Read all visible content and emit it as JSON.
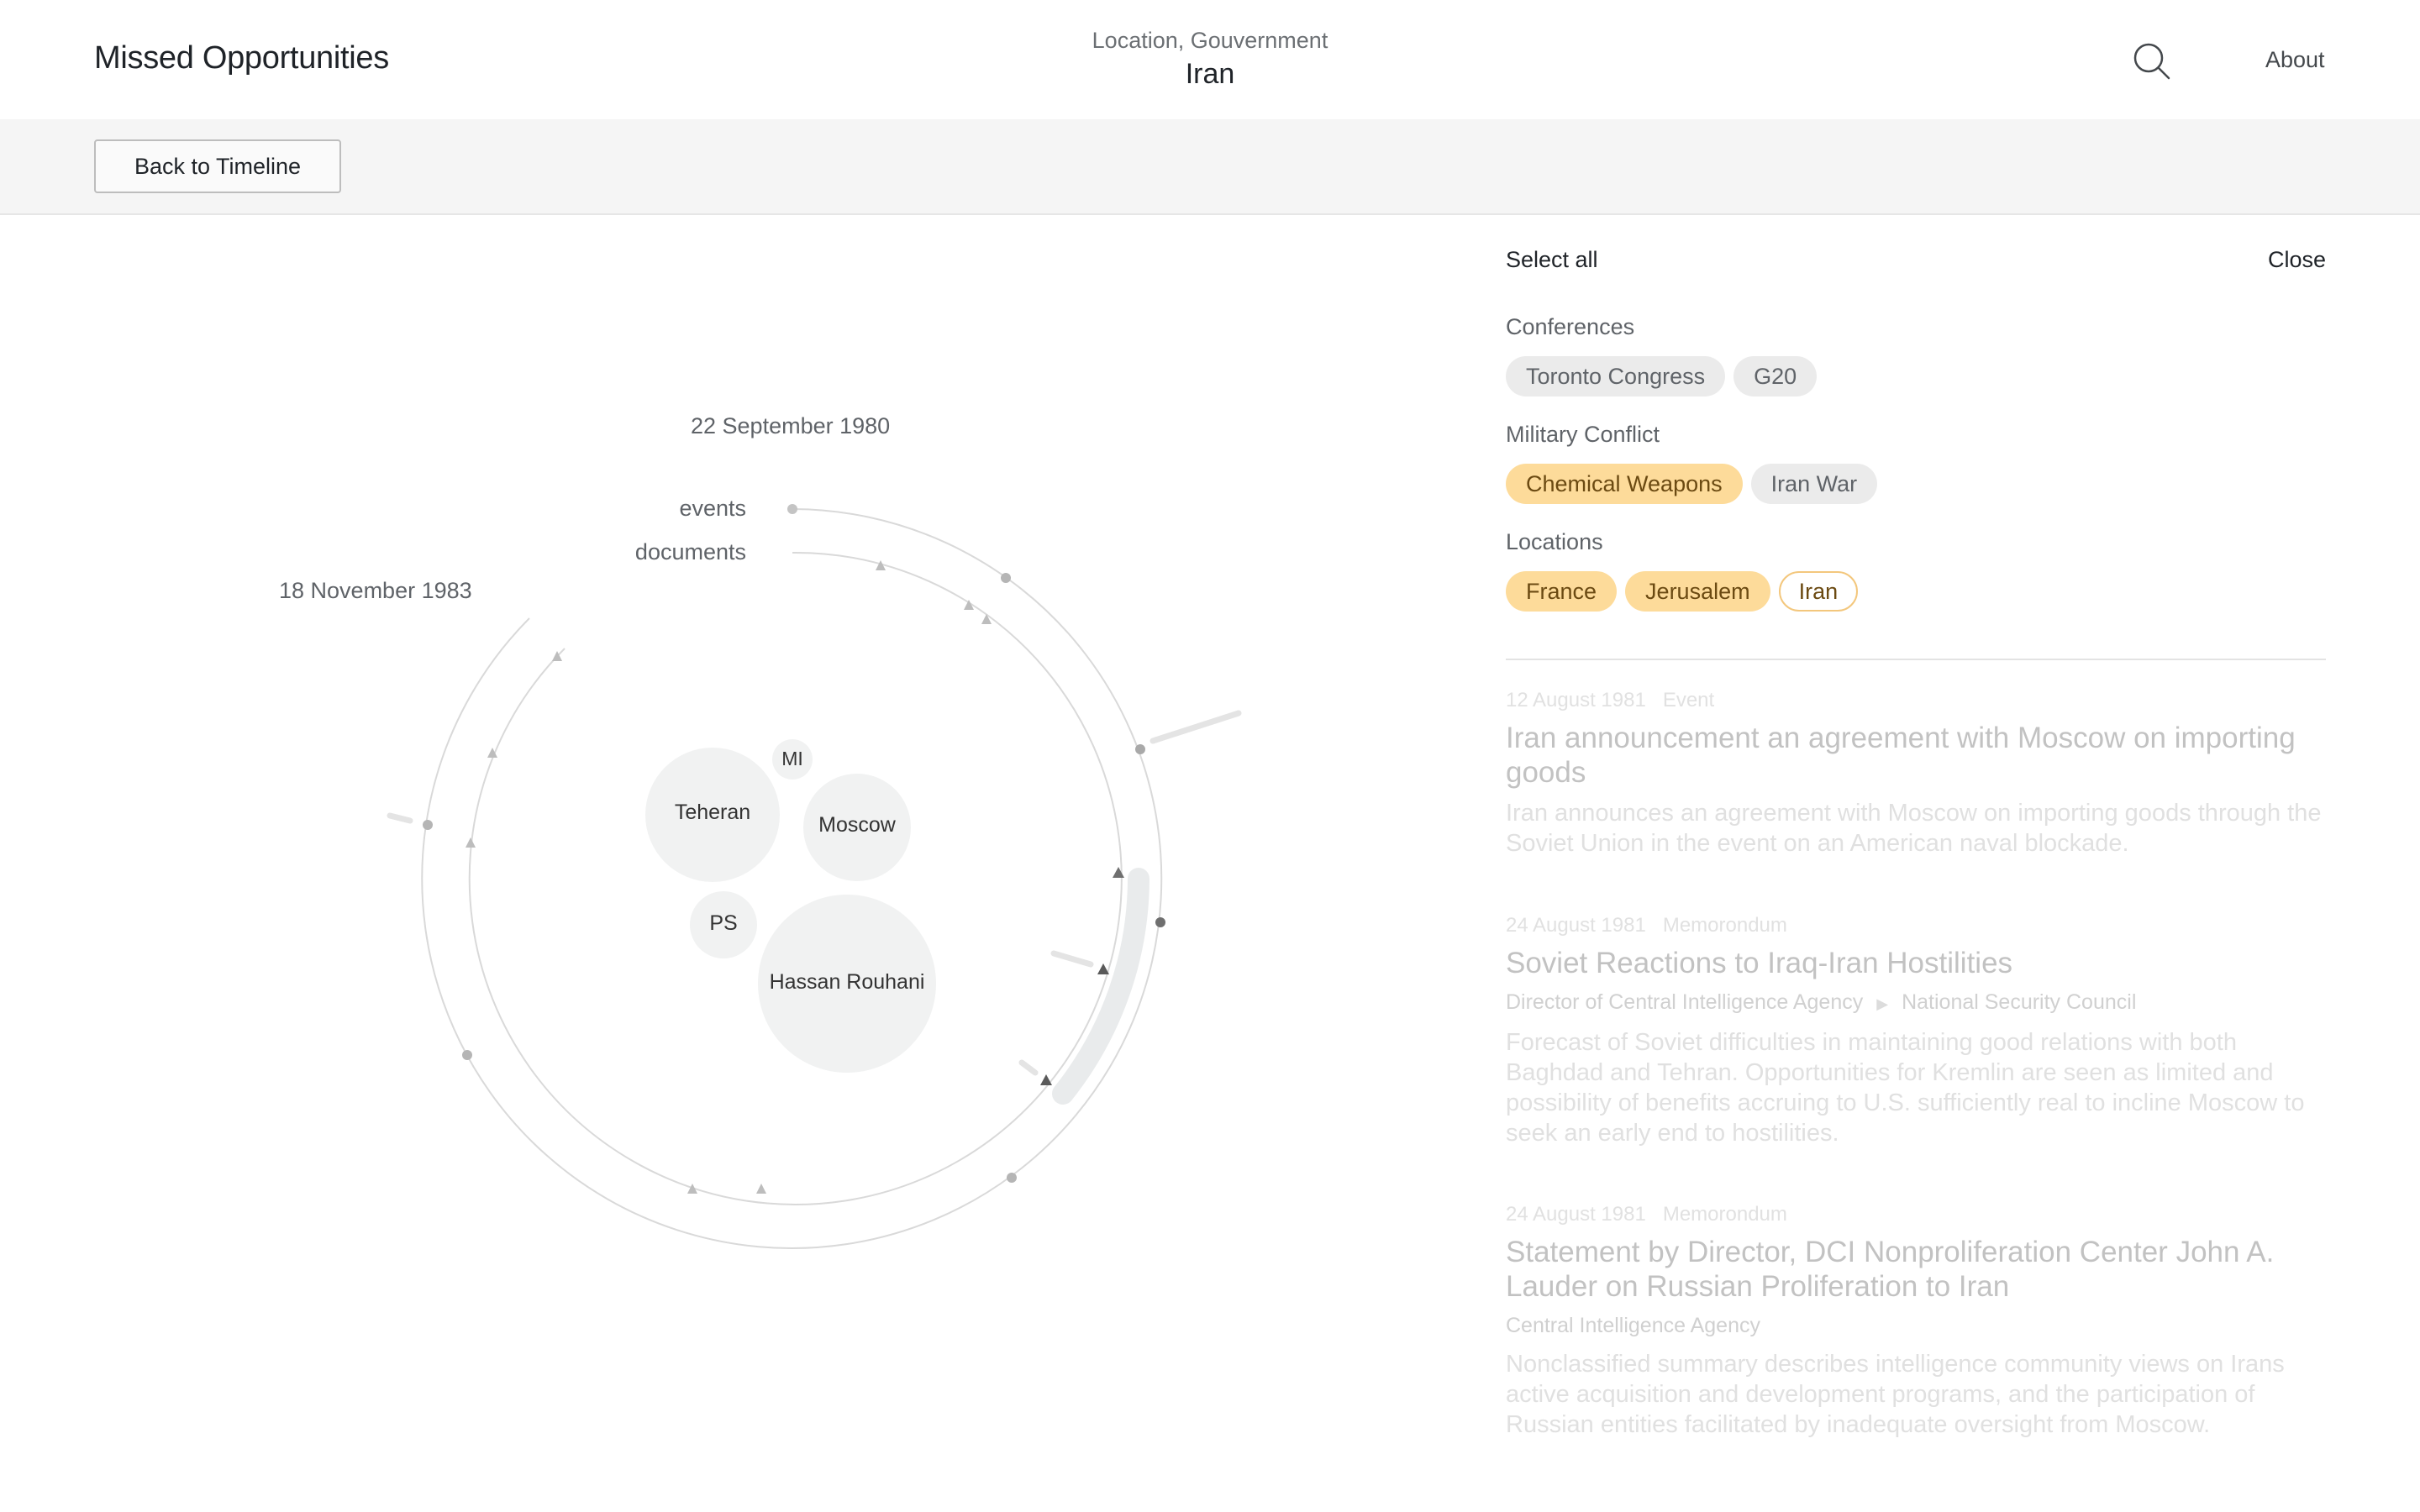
{
  "header": {
    "app_title": "Missed Opportunities",
    "context_kicker": "Location, Gouvernment",
    "context_title": "Iran",
    "search_icon": "search-icon",
    "about_label": "About"
  },
  "toolbar": {
    "back_label": "Back to Timeline"
  },
  "viz": {
    "date_start": "22 September 1980",
    "date_end": "18 November 1983",
    "ring_events_label": "events",
    "ring_documents_label": "documents",
    "bubbles": [
      {
        "label": "MI"
      },
      {
        "label": "Teheran"
      },
      {
        "label": "Moscow"
      },
      {
        "label": "PS"
      },
      {
        "label": "Hassan Rouhani"
      }
    ]
  },
  "panel": {
    "select_all": "Select all",
    "close": "Close",
    "groups": [
      {
        "title": "Conferences",
        "chips": [
          {
            "label": "Toronto Congress",
            "state": "off"
          },
          {
            "label": "G20",
            "state": "off"
          }
        ]
      },
      {
        "title": "Military Conflict",
        "chips": [
          {
            "label": "Chemical Weapons",
            "state": "on"
          },
          {
            "label": "Iran War",
            "state": "off"
          }
        ]
      },
      {
        "title": "Locations",
        "chips": [
          {
            "label": "France",
            "state": "on"
          },
          {
            "label": "Jerusalem",
            "state": "on"
          },
          {
            "label": "Iran",
            "state": "outline"
          }
        ]
      }
    ],
    "results": [
      {
        "date": "12 August 1981",
        "type": "Event",
        "title": "Iran announcement an agreement with Moscow on importing goods",
        "from": "",
        "to": "",
        "body": "Iran announces an agreement with Moscow on importing goods through the Soviet Union in the event on an American naval blockade."
      },
      {
        "date": "24 August 1981",
        "type": "Memorondum",
        "title": "Soviet Reactions to Iraq-Iran Hostilities",
        "from": "Director of Central Intelligence Agency",
        "to": "National Security Council",
        "body": "Forecast of Soviet difficulties in maintaining good relations with both Baghdad and Tehran. Opportunities for Kremlin are seen as limited and possibility of benefits accruing to U.S. sufficiently real to incline Moscow to seek an early end to hostilities."
      },
      {
        "date": "24 August 1981",
        "type": "Memorondum",
        "title": "Statement by Director, DCI Nonproliferation Center John A. Lauder on Russian Proliferation to Iran",
        "from": "Central Intelligence Agency",
        "to": "",
        "body": "Nonclassified summary describes intelligence community views on Irans active acquisition and development programs, and the participation of Russian entities facilitated by inadequate oversight from Moscow."
      }
    ]
  },
  "colors": {
    "chip_selected": "#fddb9a",
    "chip_default": "#ebebeb",
    "chip_outline": "#f3c77d",
    "toolbar_bg": "#f5f5f5"
  }
}
